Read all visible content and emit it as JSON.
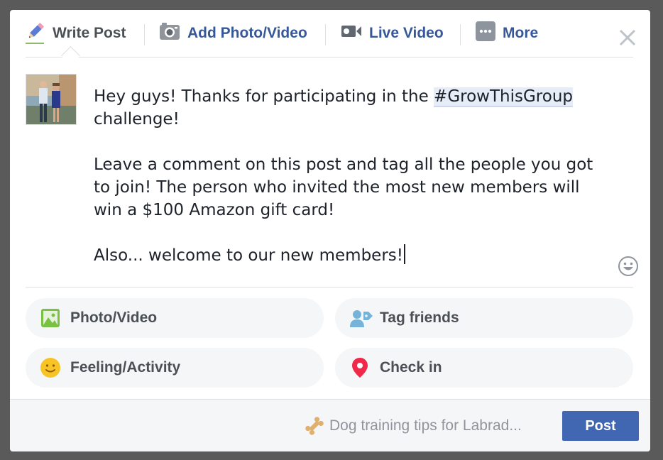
{
  "tabs": {
    "write_post": "Write Post",
    "add_photo_video": "Add Photo/Video",
    "live_video": "Live Video",
    "more": "More"
  },
  "composer": {
    "line1_prefix": "Hey guys! Thanks for participating in the ",
    "hashtag": "#GrowThisGroup",
    "line1_suffix": "challenge!",
    "paragraph2": "Leave a comment on this post and tag all the people you got to join! The person who invited the most new members will win a $100 Amazon gift card!",
    "paragraph3": "Also... welcome to our new members!"
  },
  "actions": {
    "photo_video": "Photo/Video",
    "tag_friends": "Tag friends",
    "feeling_activity": "Feeling/Activity",
    "check_in": "Check in"
  },
  "footer": {
    "suggestion": "Dog training tips for Labrad...",
    "post_label": "Post"
  },
  "colors": {
    "accent": "#4267b2",
    "link": "#365899",
    "text": "#4b4f56",
    "pill_bg": "#f5f6f7"
  },
  "icons": {
    "write": "pencil-icon",
    "photo": "camera-icon",
    "live": "video-camera-icon",
    "more": "more-dots-icon",
    "close": "close-icon",
    "emoji": "smiley-icon",
    "photo_action": "photo-icon",
    "tag": "tag-friends-icon",
    "feeling": "feeling-smiley-icon",
    "checkin": "location-pin-icon",
    "suggestion": "bone-icon"
  }
}
